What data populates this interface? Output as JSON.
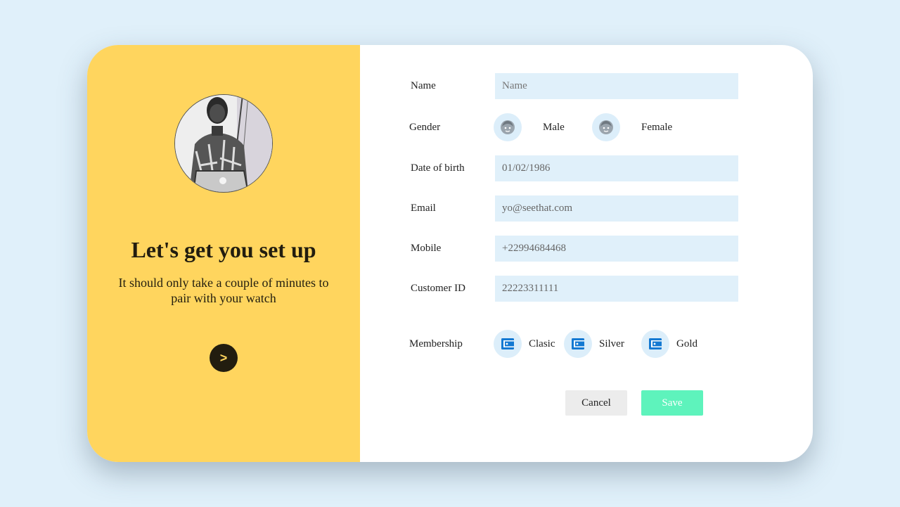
{
  "intro": {
    "title": "Let's get you set up",
    "subtitle": "It should only take a couple of minutes to pair with your watch",
    "next_label": ">"
  },
  "form": {
    "name": {
      "label": "Name",
      "placeholder": "Name",
      "value": ""
    },
    "gender": {
      "label": "Gender",
      "options": [
        {
          "label": "Male",
          "icon": "face-icon"
        },
        {
          "label": "Female",
          "icon": "face-icon"
        }
      ]
    },
    "dob": {
      "label": "Date of birth",
      "value": "01/02/1986"
    },
    "email": {
      "label": "Email",
      "value": "yo@seethat.com"
    },
    "mobile": {
      "label": "Mobile",
      "value": "+22994684468"
    },
    "customer_id": {
      "label": "Customer ID",
      "value": "22223311111"
    },
    "membership": {
      "label": "Membership",
      "options": [
        {
          "label": "Clasic",
          "icon": "wallet-icon"
        },
        {
          "label": "Silver",
          "icon": "wallet-icon"
        },
        {
          "label": "Gold",
          "icon": "wallet-icon"
        }
      ]
    }
  },
  "actions": {
    "cancel_label": "Cancel",
    "save_label": "Save"
  },
  "colors": {
    "background": "#e0f0fa",
    "panel": "#ffd55e",
    "dark": "#221d0f",
    "field_bg": "#e0f0fa",
    "save": "#5ef3bc",
    "cancel": "#ececec",
    "wallet": "#1479d2",
    "face": "#9aa4ad"
  }
}
